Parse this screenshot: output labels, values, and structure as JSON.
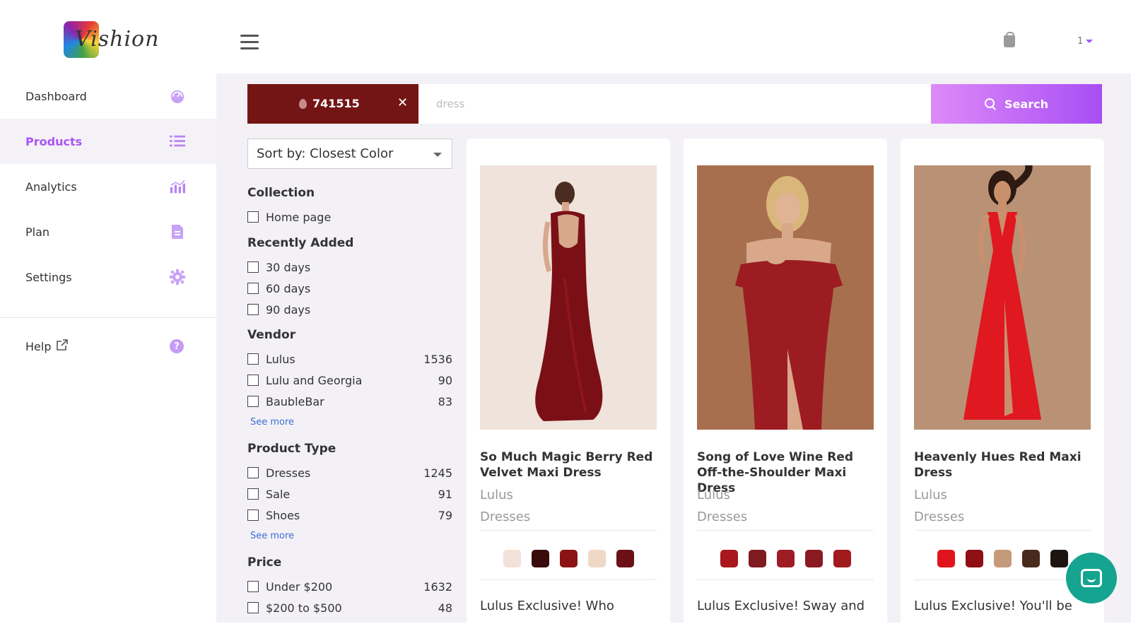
{
  "app": {
    "logo_text": "Vishion",
    "user_label": "1"
  },
  "colors": {
    "accent": "#a855f7",
    "chip": "#741515",
    "chat": "#14a48f",
    "link": "#3b6fd4"
  },
  "sidebar": {
    "items": [
      {
        "label": "Dashboard",
        "icon": "gauge-icon"
      },
      {
        "label": "Products",
        "icon": "list-icon",
        "active": true
      },
      {
        "label": "Analytics",
        "icon": "bar-chart-icon"
      },
      {
        "label": "Plan",
        "icon": "document-icon"
      },
      {
        "label": "Settings",
        "icon": "gear-icon"
      }
    ],
    "help": {
      "label": "Help",
      "icon": "question-icon"
    }
  },
  "search": {
    "color_chip_value": "741515",
    "placeholder": "dress",
    "button_label": "Search"
  },
  "filters": {
    "sort_label": "Sort by: Closest Color",
    "collection": {
      "heading": "Collection",
      "options": [
        {
          "label": "Home page"
        }
      ]
    },
    "recently_added": {
      "heading": "Recently Added",
      "options": [
        {
          "label": "30 days"
        },
        {
          "label": "60 days"
        },
        {
          "label": "90 days"
        }
      ]
    },
    "vendor": {
      "heading": "Vendor",
      "options": [
        {
          "label": "Lulus",
          "count": "1536"
        },
        {
          "label": "Lulu and Georgia",
          "count": "90"
        },
        {
          "label": "BaubleBar",
          "count": "83"
        }
      ],
      "see_more": "See more"
    },
    "product_type": {
      "heading": "Product Type",
      "options": [
        {
          "label": "Dresses",
          "count": "1245"
        },
        {
          "label": "Sale",
          "count": "91"
        },
        {
          "label": "Shoes",
          "count": "79"
        }
      ],
      "see_more": "See more"
    },
    "price": {
      "heading": "Price",
      "options": [
        {
          "label": "Under $200",
          "count": "1632"
        },
        {
          "label": "$200 to $500",
          "count": "48"
        }
      ]
    }
  },
  "products": [
    {
      "title": "So Much Magic Berry Red Velvet Maxi Dress",
      "vendor": "Lulus",
      "type": "Dresses",
      "swatches": [
        "#f2e2da",
        "#3a0b0b",
        "#8c1313",
        "#efd9c6",
        "#6c1018"
      ],
      "description": "Lulus Exclusive! Who"
    },
    {
      "title": "Song of Love Wine Red Off-the-Shoulder Maxi Dress",
      "vendor": "Lulus",
      "type": "Dresses",
      "swatches": [
        "#a8161e",
        "#7f1a20",
        "#9e1c24",
        "#8a1a22",
        "#a01a1e"
      ],
      "description": "Lulus Exclusive! Sway and"
    },
    {
      "title": "Heavenly Hues Red Maxi Dress",
      "vendor": "Lulus",
      "type": "Dresses",
      "swatches": [
        "#e0141c",
        "#8e0f14",
        "#c49a7a",
        "#4a2a1c",
        "#1c1410"
      ],
      "description": "Lulus Exclusive! You'll be"
    }
  ]
}
